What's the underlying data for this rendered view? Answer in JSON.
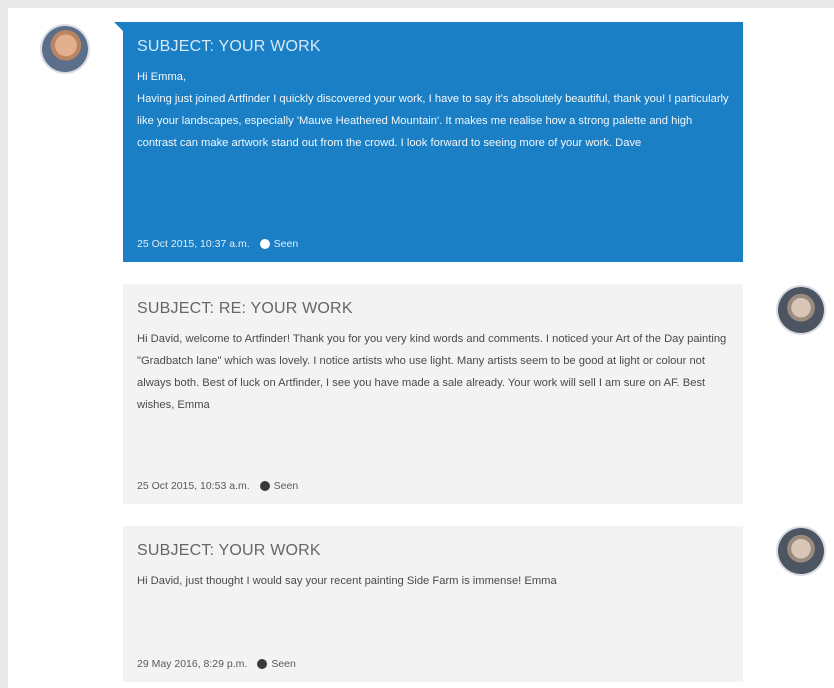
{
  "messages": [
    {
      "subject": "SUBJECT: YOUR WORK",
      "greeting": "Hi Emma,",
      "body": "Having just joined Artfinder I quickly discovered your work, I have to say it's absolutely beautiful, thank you! I particularly like your landscapes, especially 'Mauve Heathered Mountain'. It makes me realise how a strong palette and high contrast can make artwork stand out from the crowd. I look forward to seeing more of your work. Dave",
      "timestamp": "25 Oct 2015, 10:37 a.m.",
      "status": "Seen"
    },
    {
      "subject": "SUBJECT: RE: YOUR WORK",
      "body": "Hi David, welcome to Artfinder! Thank you for you very kind words and comments. I noticed your Art of the Day painting \"Gradbatch lane\" which was lovely. I notice artists who use light. Many artists seem to be good at light or colour not always both. Best of luck on Artfinder, I see you have made a sale already. Your work will sell I am sure on AF. Best wishes, Emma",
      "timestamp": "25 Oct 2015, 10:53 a.m.",
      "status": "Seen"
    },
    {
      "subject": "SUBJECT: YOUR WORK",
      "body": "Hi David, just thought I would say your recent painting Side Farm is immense! Emma",
      "timestamp": "29 May 2016, 8:29 p.m.",
      "status": "Seen"
    }
  ],
  "colors": {
    "sent_bubble": "#1a7fc4",
    "received_bubble": "#f3f3f3",
    "background": "#e9e9ea"
  },
  "icons": {
    "avatar_sender": "avatar",
    "avatar_recipient": "avatar",
    "seen": "seen-icon"
  }
}
